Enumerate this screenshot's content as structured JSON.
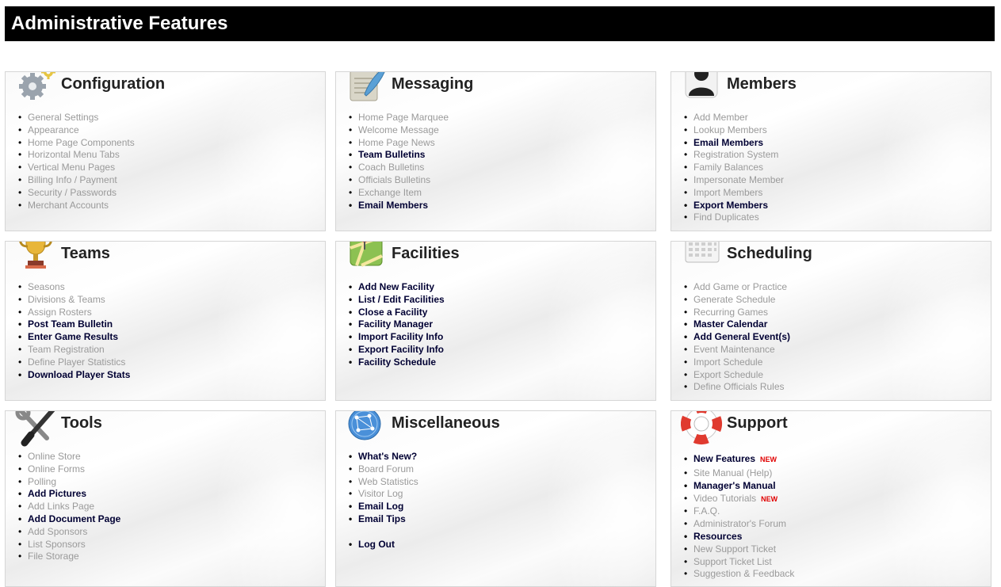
{
  "page_title": "Administrative Features",
  "panels": {
    "configuration": {
      "title": "Configuration",
      "icon": "gears-icon",
      "items": [
        {
          "label": "General Settings"
        },
        {
          "label": "Appearance"
        },
        {
          "label": "Home Page Components"
        },
        {
          "label": "Horizontal Menu Tabs"
        },
        {
          "label": "Vertical Menu Pages"
        },
        {
          "label": "Billing Info / Payment"
        },
        {
          "label": "Security / Passwords"
        },
        {
          "label": "Merchant Accounts"
        }
      ]
    },
    "messaging": {
      "title": "Messaging",
      "icon": "notepad-quill-icon",
      "items": [
        {
          "label": "Home Page Marquee"
        },
        {
          "label": "Welcome Message"
        },
        {
          "label": "Home Page News"
        },
        {
          "label": "Team Bulletins"
        },
        {
          "label": "Coach Bulletins"
        },
        {
          "label": "Officials Bulletins"
        },
        {
          "label": "Exchange Item"
        },
        {
          "label": "Email Members"
        }
      ]
    },
    "members": {
      "title": "Members",
      "icon": "person-silhouette-icon",
      "items": [
        {
          "label": "Add Member"
        },
        {
          "label": "Lookup Members"
        },
        {
          "label": "Email Members"
        },
        {
          "label": "Registration System"
        },
        {
          "label": "Family Balances"
        },
        {
          "label": "Impersonate Member"
        },
        {
          "label": "Import Members"
        },
        {
          "label": "Export Members"
        },
        {
          "label": "Find Duplicates"
        }
      ]
    },
    "teams": {
      "title": "Teams",
      "icon": "trophy-icon",
      "items": [
        {
          "label": "Seasons"
        },
        {
          "label": "Divisions & Teams"
        },
        {
          "label": "Assign Rosters"
        },
        {
          "label": "Post Team Bulletin"
        },
        {
          "label": "Enter Game Results"
        },
        {
          "label": "Team Registration"
        },
        {
          "label": "Define Player Statistics"
        },
        {
          "label": "Download Player Stats"
        }
      ]
    },
    "facilities": {
      "title": "Facilities",
      "icon": "map-pin-icon",
      "items": [
        {
          "label": "Add New Facility"
        },
        {
          "label": "List / Edit Facilities"
        },
        {
          "label": "Close a Facility"
        },
        {
          "label": "Facility Manager"
        },
        {
          "label": "Import Facility Info"
        },
        {
          "label": "Export Facility Info"
        },
        {
          "label": "Facility Schedule"
        }
      ]
    },
    "scheduling": {
      "title": "Scheduling",
      "icon": "calendar-icon",
      "items": [
        {
          "label": "Add Game or Practice"
        },
        {
          "label": "Generate Schedule"
        },
        {
          "label": "Recurring Games"
        },
        {
          "label": "Master Calendar"
        },
        {
          "label": "Add General Event(s)"
        },
        {
          "label": "Event Maintenance"
        },
        {
          "label": "Import Schedule"
        },
        {
          "label": "Export Schedule"
        },
        {
          "label": "Define Officials Rules"
        }
      ]
    },
    "tools": {
      "title": "Tools",
      "icon": "wrench-screwdriver-icon",
      "items": [
        {
          "label": "Online Store"
        },
        {
          "label": "Online Forms"
        },
        {
          "label": "Polling"
        },
        {
          "label": "Add Pictures"
        },
        {
          "label": "Add Links Page"
        },
        {
          "label": "Add Document Page"
        },
        {
          "label": "Add Sponsors"
        },
        {
          "label": "List Sponsors"
        },
        {
          "label": "File Storage"
        }
      ]
    },
    "miscellaneous": {
      "title": "Miscellaneous",
      "icon": "globe-network-icon",
      "items": [
        {
          "label": "What's New?"
        },
        {
          "label": "Board Forum"
        },
        {
          "label": "Web Statistics"
        },
        {
          "label": "Visitor Log"
        },
        {
          "label": "Email Log"
        },
        {
          "label": "Email Tips"
        },
        {
          "label": "Log Out"
        }
      ]
    },
    "support": {
      "title": "Support",
      "icon": "lifebuoy-icon",
      "items": [
        {
          "label": "New Features",
          "badge": "NEW"
        },
        {
          "label": "Site Manual (Help)"
        },
        {
          "label": "Manager's Manual"
        },
        {
          "label": "Video Tutorials",
          "badge": "NEW"
        },
        {
          "label": "F.A.Q."
        },
        {
          "label": "Administrator's Forum"
        },
        {
          "label": "Resources"
        },
        {
          "label": "New Support Ticket"
        },
        {
          "label": "Support Ticket List"
        },
        {
          "label": "Suggestion & Feedback"
        }
      ]
    }
  },
  "colors": {
    "header_bg": "#000000",
    "active_link": "#000033",
    "inactive_link": "#9a9a9a",
    "new_badge": "#e00000"
  }
}
